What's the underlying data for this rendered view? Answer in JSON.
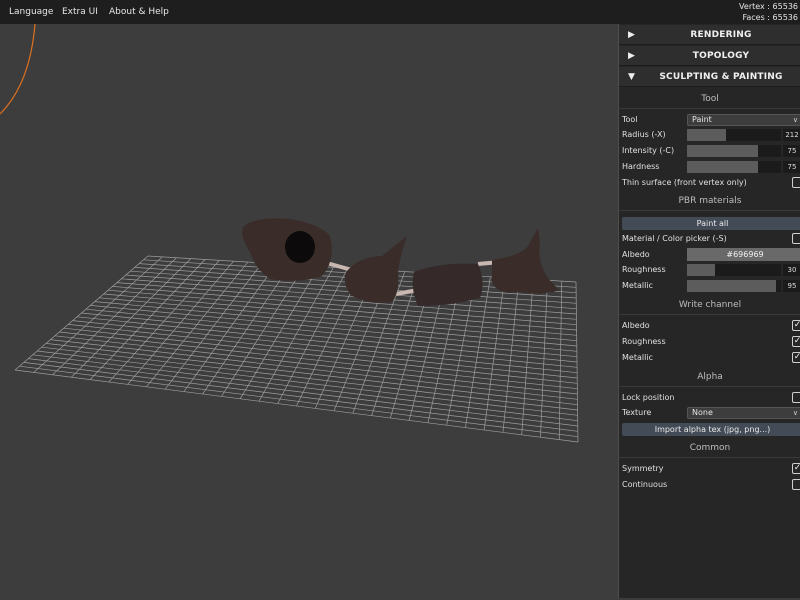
{
  "menu": {
    "language": "Language",
    "extra_ui": "Extra UI",
    "about_help": "About & Help"
  },
  "stats": {
    "vertex": "Vertex : 65536",
    "faces": "Faces : 65536"
  },
  "panel": {
    "rendering": "RENDERING",
    "topology": "TOPOLOGY",
    "sculpting": "SCULPTING & PAINTING",
    "tool_section": "Tool",
    "tool_label": "Tool",
    "tool_value": "Paint",
    "radius_label": "Radius (-X)",
    "radius_value": "212",
    "radius_fraction": 0.42,
    "intensity_label": "Intensity (-C)",
    "intensity_value": "75",
    "intensity_fraction": 0.75,
    "hardness_label": "Hardness",
    "hardness_value": "75",
    "hardness_fraction": 0.75,
    "thin_surface_label": "Thin surface (front vertex only)",
    "thin_surface_checked": false,
    "pbr_section": "PBR materials",
    "paint_all": "Paint all",
    "material_picker_label": "Material / Color picker (-S)",
    "material_picker_checked": false,
    "albedo_label": "Albedo",
    "albedo_value": "#696969",
    "roughness_label": "Roughness",
    "roughness_value": "30",
    "roughness_fraction": 0.3,
    "metallic_label": "Metallic",
    "metallic_value": "95",
    "metallic_fraction": 0.95,
    "write_section": "Write channel",
    "write_albedo_label": "Albedo",
    "write_albedo_checked": true,
    "write_roughness_label": "Roughness",
    "write_roughness_checked": true,
    "write_metallic_label": "Metallic",
    "write_metallic_checked": true,
    "alpha_section": "Alpha",
    "lock_position_label": "Lock position",
    "lock_position_checked": false,
    "texture_label": "Texture",
    "texture_value": "None",
    "import_alpha": "Import alpha tex (jpg, png...)",
    "common_section": "Common",
    "symmetry_label": "Symmetry",
    "symmetry_checked": true,
    "continuous_label": "Continuous",
    "continuous_checked": false
  },
  "icons": {
    "collapsed": "triangle-right-icon",
    "expanded": "triangle-down-icon",
    "check": "checkmark-icon",
    "dropdown": "chevron-down-icon"
  },
  "colors": {
    "panel_bg": "#262626",
    "viewport_bg": "#3d3d3d",
    "button": "#434b56",
    "albedo": "#696969",
    "mesh": "#3a2d29",
    "grid": "#a8a8a8",
    "arc": "#e0701e"
  }
}
